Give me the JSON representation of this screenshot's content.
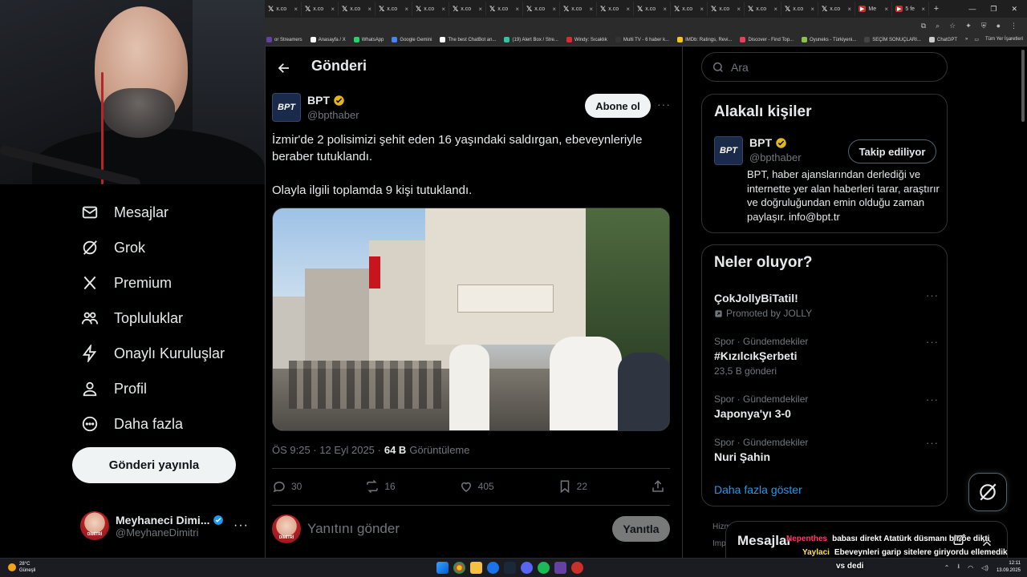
{
  "browser": {
    "tabs": [
      {
        "label": "x.co"
      },
      {
        "label": "x.co"
      },
      {
        "label": "x.co"
      },
      {
        "label": "x.co"
      },
      {
        "label": "x.co"
      },
      {
        "label": "x.co"
      },
      {
        "label": "x.co"
      },
      {
        "label": "x.co"
      },
      {
        "label": "x.co"
      },
      {
        "label": "x.co"
      },
      {
        "label": "x.co"
      },
      {
        "label": "x.co"
      },
      {
        "label": "x.co"
      },
      {
        "label": "x.co"
      },
      {
        "label": "x.co"
      },
      {
        "label": "x.co"
      },
      {
        "label": "Me"
      },
      {
        "label": "5 fe"
      }
    ],
    "bookmarks": [
      {
        "label": "or Streamers",
        "color": "#6441a5"
      },
      {
        "label": "Anasayfa / X",
        "color": "#ffffff"
      },
      {
        "label": "WhatsApp",
        "color": "#25d366"
      },
      {
        "label": "Google Gemini",
        "color": "#4285f4"
      },
      {
        "label": "The best ChatBot an...",
        "color": "#ffffff"
      },
      {
        "label": "(19) Alert Box / Stre...",
        "color": "#31c3a2"
      },
      {
        "label": "Windy: Sıcaklık",
        "color": "#d92d2d"
      },
      {
        "label": "Multi TV - 6 haber k...",
        "color": "#333333"
      },
      {
        "label": "IMDb: Ratings, Revi...",
        "color": "#f5c518"
      },
      {
        "label": "Discover - Find Top...",
        "color": "#e4405f"
      },
      {
        "label": "Oyuneks - Türkiyeni...",
        "color": "#8bc34a"
      },
      {
        "label": "SEÇİM SONUÇLARI...",
        "color": "#444444"
      },
      {
        "label": "ChatGPT",
        "color": "#cccccc"
      }
    ],
    "all_bookmarks": "Tüm Yer İşaretleri"
  },
  "nav": {
    "items": [
      {
        "label": "Mesajlar",
        "icon": "mail-icon"
      },
      {
        "label": "Grok",
        "icon": "grok-icon"
      },
      {
        "label": "Premium",
        "icon": "x-logo-icon"
      },
      {
        "label": "Topluluklar",
        "icon": "communities-icon"
      },
      {
        "label": "Onaylı Kuruluşlar",
        "icon": "lightning-icon"
      },
      {
        "label": "Profil",
        "icon": "person-icon"
      },
      {
        "label": "Daha fazla",
        "icon": "more-circle-icon"
      }
    ],
    "post_button": "Gönderi yayınla",
    "account": {
      "display_name": "Meyhaneci Dimi...",
      "username": "@MeyhaneDimitri",
      "avatar_caption": "DİMİTRİ"
    }
  },
  "main": {
    "title": "Gönderi",
    "post": {
      "author_display": "BPT",
      "author_username": "@bpthaber",
      "avatar_text": "BPT",
      "subscribe_label": "Abone ol",
      "text_line1": "İzmir'de 2 polisimizi şehit eden 16 yaşındaki saldırgan, ebeveynleriyle beraber tutuklandı.",
      "text_line2": "Olayla ilgili toplamda 9 kişi tutuklandı.",
      "time": "ÖS 9:25 · 12 Eyl 2025 ·",
      "views_count": "64 B",
      "views_label": "Görüntüleme",
      "stats": {
        "replies": "30",
        "reposts": "16",
        "likes": "405",
        "bookmarks": "22"
      }
    },
    "reply": {
      "placeholder": "Yanıtını gönder",
      "button": "Yanıtla"
    }
  },
  "sidebar": {
    "search_placeholder": "Ara",
    "related": {
      "title": "Alakalı kişiler",
      "user": {
        "display": "BPT",
        "username": "@bpthaber",
        "avatar_text": "BPT"
      },
      "follow_label": "Takip ediliyor",
      "bio": "BPT, haber ajanslarından derlediği ve internette yer alan haberleri tarar, araştırır ve doğruluğundan emin olduğu zaman paylaşır. info@bpt.tr"
    },
    "trends": {
      "title": "Neler oluyor?",
      "items": [
        {
          "meta": "",
          "name": "ÇokJollyBiTatil!",
          "count": "Promoted by JOLLY"
        },
        {
          "meta": "Spor · Gündemdekiler",
          "name": "#KızılcıkŞerbeti",
          "count": "23,5 B gönderi"
        },
        {
          "meta": "Spor · Gündemdekiler",
          "name": "Japonya'yı 3-0",
          "count": ""
        },
        {
          "meta": "Spor · Gündemdekiler",
          "name": "Nuri Şahin",
          "count": ""
        }
      ],
      "show_more": "Daha fazla göster"
    },
    "peek1": "Hizm",
    "peek2": "Imp"
  },
  "dm": {
    "title": "Mesajlar"
  },
  "chat": {
    "lines": [
      {
        "user": "Nepenthes",
        "msg": "babası direkt Atatürk düsmanı bir oe dikti"
      },
      {
        "user": "Yaylaci",
        "msg": "Ebeveynleri garip sitelere giriyordu ellemedik"
      }
    ],
    "continuation": "vs dedi"
  },
  "taskbar": {
    "weather_temp": "28°C",
    "weather_desc": "Güneşli",
    "time": "12:11",
    "date": "13.09.2025"
  }
}
